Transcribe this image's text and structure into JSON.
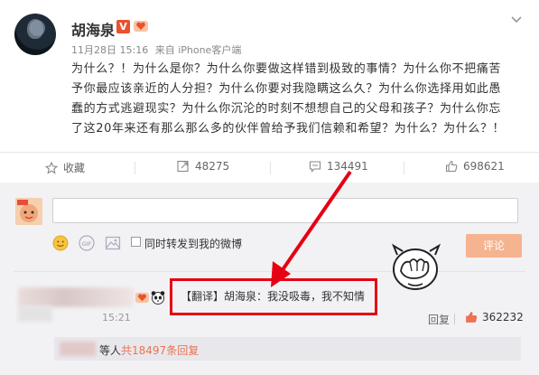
{
  "post": {
    "author": "胡海泉",
    "verified_badge": "V",
    "time": "11月28日 15:16",
    "source": "来自 iPhone客户端",
    "text_lines": [
      "为什么？！为什么是你？为什么你要做这样错到极致的事情？为什么你不把痛苦",
      "予你最应该亲近的人分担？为什么你要对我隐瞒这么久？为什么你选择用如此愚",
      "蠢的方式逃避现实？为什么你沉沦的时刻不想想自己的父母和孩子？为什么你忘",
      "了这20年来还有那么那么多的伙伴曾给予我们信赖和希望？为什么？为什么？！"
    ]
  },
  "actions": {
    "favorite_label": "收藏",
    "forward_count": "48275",
    "comment_count": "134491",
    "like_count": "698621"
  },
  "composer": {
    "forward_checkbox_label": "同时转发到我的微博",
    "comment_button": "评论"
  },
  "comment": {
    "translate_tag": "【翻译】",
    "translate_name": "胡海泉：",
    "translate_text": "我没吸毒，我不知情",
    "time": "15:21",
    "reply_label": "回复",
    "like_count": "362232",
    "replies_prefix": "等人",
    "replies_count": "共18497条回复"
  },
  "colors": {
    "accent_orange": "#eb7350",
    "highlight_red": "#e60012",
    "button_disabled": "#f6b38f"
  },
  "icons": [
    "chevron-down-icon",
    "star-icon",
    "forward-icon",
    "comment-icon",
    "thumbs-up-icon",
    "smiley-icon",
    "gif-icon",
    "image-icon"
  ]
}
